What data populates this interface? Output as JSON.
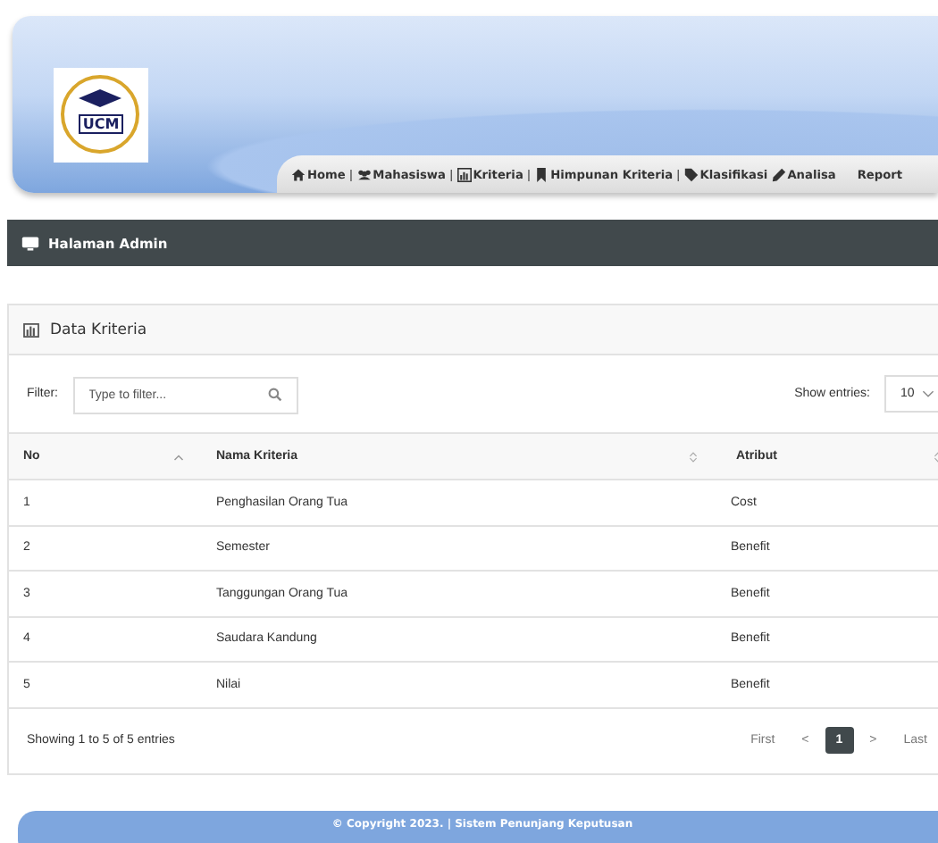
{
  "header": {
    "logo_text": "UCM"
  },
  "nav": [
    {
      "kind": "link",
      "label": "Home"
    },
    {
      "kind": "separator",
      "label": "|"
    },
    {
      "kind": "link",
      "label": "Mahasiswa"
    },
    {
      "kind": "separator",
      "label": "|"
    },
    {
      "kind": "link",
      "label": "Kriteria"
    },
    {
      "kind": "separator",
      "label": "|"
    },
    {
      "kind": "link",
      "label": "Himpunan Kriteria"
    },
    {
      "kind": "separator",
      "label": "|"
    },
    {
      "kind": "link",
      "label": "Klasifikasi"
    },
    {
      "kind": "link",
      "label": "Analisa"
    },
    {
      "kind": "link",
      "label": "Report"
    }
  ],
  "admin_bar": {
    "title": "Halaman Admin"
  },
  "card": {
    "title": "Data Kriteria",
    "filter": {
      "label": "Filter:",
      "placeholder": "Type to filter..."
    },
    "entries": {
      "label": "Show entries:",
      "value": "10"
    },
    "table": {
      "columns": [
        {
          "label": "No",
          "sorted_ascending": true
        },
        {
          "label": "Nama Kriteria",
          "sorted_ascending": false
        },
        {
          "label": "Atribut",
          "sorted_ascending": false
        }
      ],
      "rows": [
        [
          "1",
          "Penghasilan Orang Tua",
          "Cost"
        ],
        [
          "2",
          "Semester",
          "Benefit"
        ],
        [
          "3",
          "Tanggungan Orang Tua",
          "Benefit"
        ],
        [
          "4",
          "Saudara Kandung",
          "Benefit"
        ],
        [
          "5",
          "Nilai",
          "Benefit"
        ]
      ]
    },
    "summary": "Showing 1 to 5 of 5 entries",
    "pagination": [
      {
        "kind": "text",
        "label": "First",
        "selected": false
      },
      {
        "kind": "text",
        "label": "<",
        "selected": false
      },
      {
        "kind": "page",
        "label": "1",
        "selected": true
      },
      {
        "kind": "text",
        "label": ">",
        "selected": false
      },
      {
        "kind": "text",
        "label": "Last",
        "selected": false
      }
    ]
  },
  "footer": {
    "text": "© Copyright 2023. | Sistem Penunjang Keputusan"
  }
}
